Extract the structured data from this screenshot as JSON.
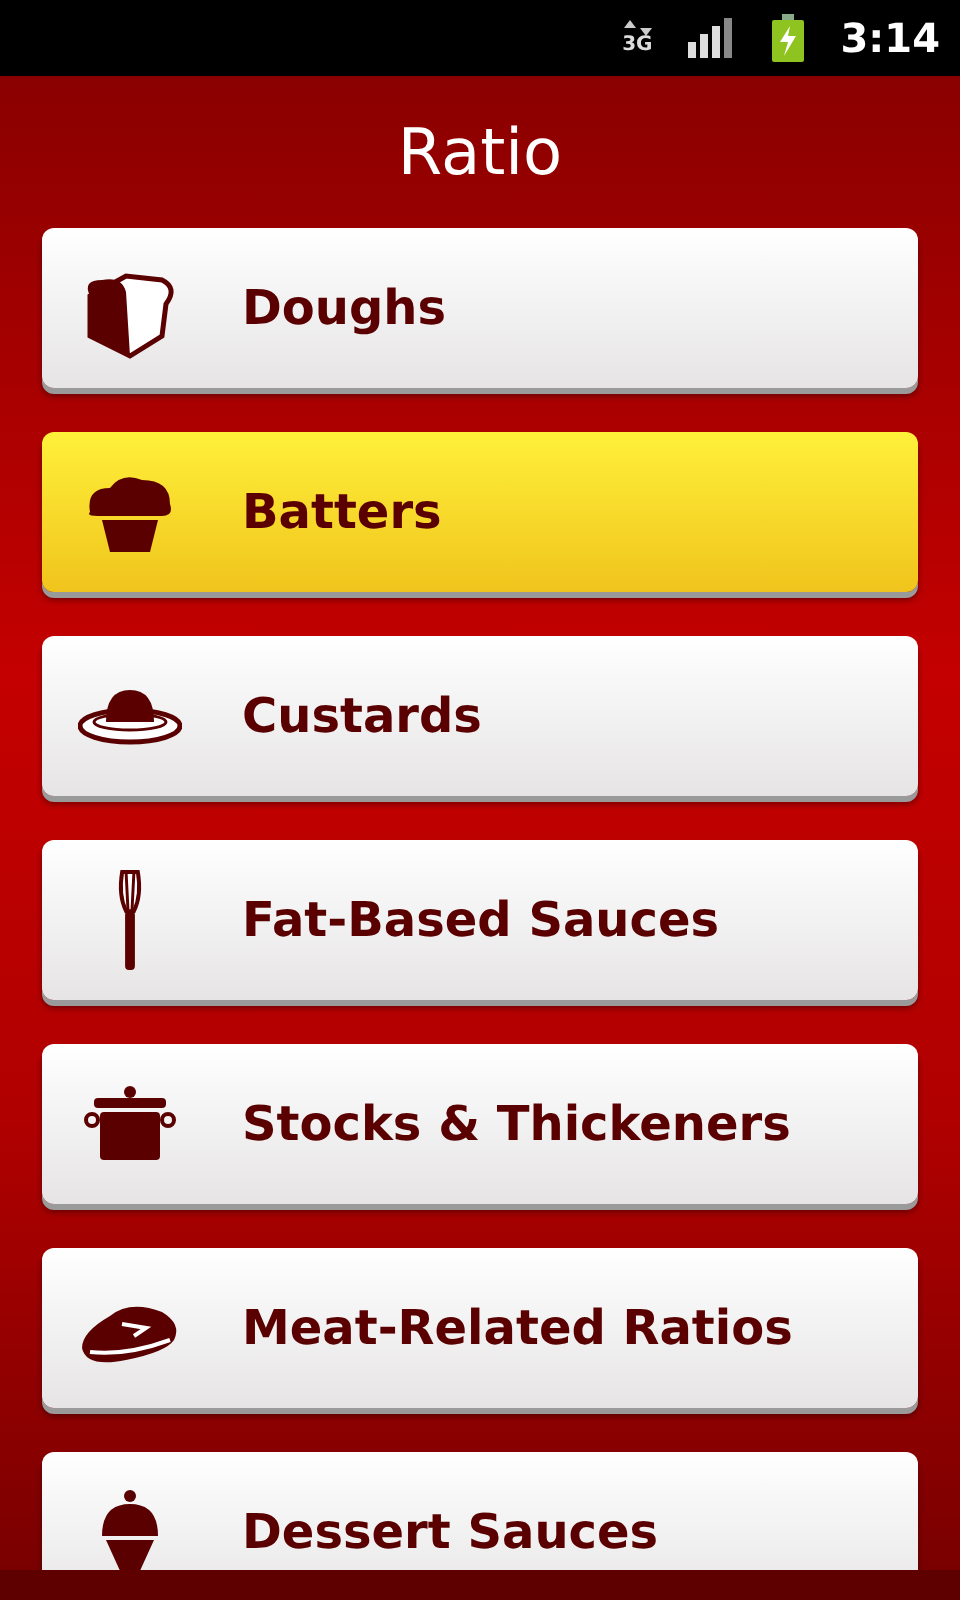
{
  "status_bar": {
    "network": "3G",
    "time": "3:14",
    "charging": true
  },
  "title": "Ratio",
  "items": [
    {
      "label": "Doughs",
      "selected": false
    },
    {
      "label": "Batters",
      "selected": true
    },
    {
      "label": "Custards",
      "selected": false
    },
    {
      "label": "Fat-Based Sauces",
      "selected": false
    },
    {
      "label": "Stocks & Thickeners",
      "selected": false
    },
    {
      "label": "Meat-Related Ratios",
      "selected": false
    },
    {
      "label": "Dessert Sauces",
      "selected": false
    }
  ]
}
